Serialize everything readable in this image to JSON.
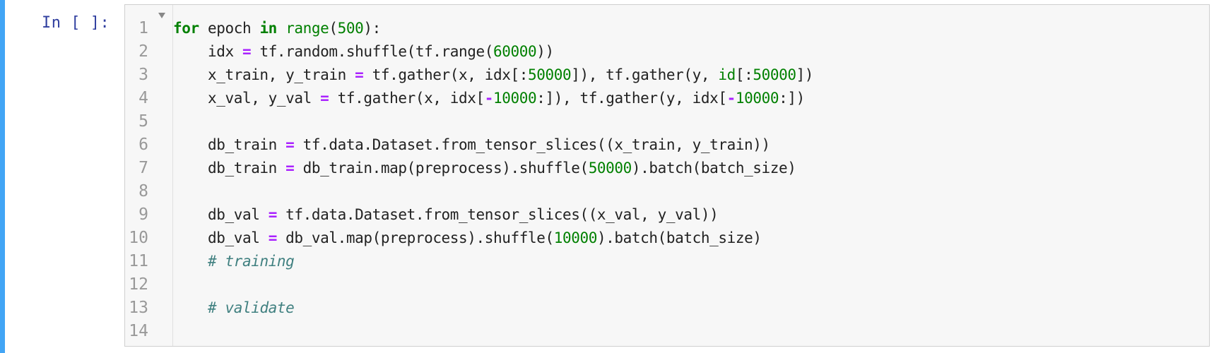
{
  "prompt": {
    "label": "In [ ]:"
  },
  "colors": {
    "selection_bar": "#42a5f5",
    "prompt": "#303f9f",
    "keyword": "#008000",
    "number": "#008000",
    "operator": "#aa22ff",
    "comment": "#408080",
    "editor_bg": "#f7f7f7"
  },
  "gutter": {
    "line_numbers": [
      "1",
      "2",
      "3",
      "4",
      "5",
      "6",
      "7",
      "8",
      "9",
      "10",
      "11",
      "12",
      "13",
      "14"
    ],
    "fold_icon": "fold-triangle-icon"
  },
  "code": {
    "lines": [
      [
        {
          "t": "kw",
          "v": "for"
        },
        {
          "t": "",
          "v": " epoch "
        },
        {
          "t": "kw",
          "v": "in"
        },
        {
          "t": "",
          "v": " "
        },
        {
          "t": "bi",
          "v": "range"
        },
        {
          "t": "",
          "v": "("
        },
        {
          "t": "num",
          "v": "500"
        },
        {
          "t": "",
          "v": "):"
        }
      ],
      [
        {
          "t": "",
          "v": "    idx "
        },
        {
          "t": "op",
          "v": "="
        },
        {
          "t": "",
          "v": " tf.random.shuffle(tf.range("
        },
        {
          "t": "num",
          "v": "60000"
        },
        {
          "t": "",
          "v": "))"
        }
      ],
      [
        {
          "t": "",
          "v": "    x_train, y_train "
        },
        {
          "t": "op",
          "v": "="
        },
        {
          "t": "",
          "v": " tf.gather(x, idx[:"
        },
        {
          "t": "num",
          "v": "50000"
        },
        {
          "t": "",
          "v": "]), tf.gather(y, "
        },
        {
          "t": "bi",
          "v": "id"
        },
        {
          "t": "",
          "v": "[:"
        },
        {
          "t": "num",
          "v": "50000"
        },
        {
          "t": "",
          "v": "])"
        }
      ],
      [
        {
          "t": "",
          "v": "    x_val, y_val "
        },
        {
          "t": "op",
          "v": "="
        },
        {
          "t": "",
          "v": " tf.gather(x, idx["
        },
        {
          "t": "op",
          "v": "-"
        },
        {
          "t": "num",
          "v": "10000"
        },
        {
          "t": "",
          "v": ":]), tf.gather(y, idx["
        },
        {
          "t": "op",
          "v": "-"
        },
        {
          "t": "num",
          "v": "10000"
        },
        {
          "t": "",
          "v": ":])"
        }
      ],
      [
        {
          "t": "",
          "v": ""
        }
      ],
      [
        {
          "t": "",
          "v": "    db_train "
        },
        {
          "t": "op",
          "v": "="
        },
        {
          "t": "",
          "v": " tf.data.Dataset.from_tensor_slices((x_train, y_train))"
        }
      ],
      [
        {
          "t": "",
          "v": "    db_train "
        },
        {
          "t": "op",
          "v": "="
        },
        {
          "t": "",
          "v": " db_train.map(preprocess).shuffle("
        },
        {
          "t": "num",
          "v": "50000"
        },
        {
          "t": "",
          "v": ").batch(batch_size)"
        }
      ],
      [
        {
          "t": "",
          "v": ""
        }
      ],
      [
        {
          "t": "",
          "v": "    db_val "
        },
        {
          "t": "op",
          "v": "="
        },
        {
          "t": "",
          "v": " tf.data.Dataset.from_tensor_slices((x_val, y_val))"
        }
      ],
      [
        {
          "t": "",
          "v": "    db_val "
        },
        {
          "t": "op",
          "v": "="
        },
        {
          "t": "",
          "v": " db_val.map(preprocess).shuffle("
        },
        {
          "t": "num",
          "v": "10000"
        },
        {
          "t": "",
          "v": ").batch(batch_size)"
        }
      ],
      [
        {
          "t": "",
          "v": "    "
        },
        {
          "t": "cm",
          "v": "# training"
        }
      ],
      [
        {
          "t": "",
          "v": ""
        }
      ],
      [
        {
          "t": "",
          "v": "    "
        },
        {
          "t": "cm",
          "v": "# validate"
        }
      ],
      [
        {
          "t": "",
          "v": ""
        }
      ]
    ]
  }
}
